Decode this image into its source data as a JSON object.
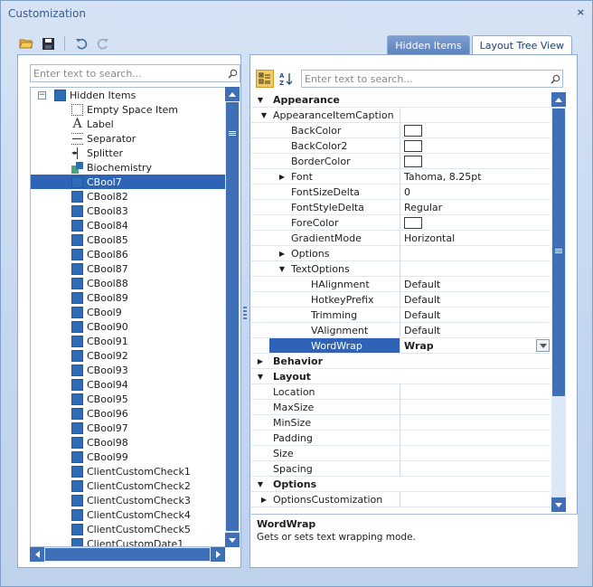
{
  "window": {
    "title": "Customization",
    "close_glyph": "×"
  },
  "toolbar": {
    "icons": [
      "open-folder-icon",
      "save-icon",
      "undo-icon",
      "redo-icon"
    ]
  },
  "tabs": [
    {
      "label": "Hidden Items",
      "active": false
    },
    {
      "label": "Layout Tree View",
      "active": true
    }
  ],
  "left": {
    "search_placeholder": "Enter text to search...",
    "tree": [
      {
        "label": "Hidden Items",
        "icon": "box",
        "level": 0,
        "expander": "minus"
      },
      {
        "label": "Empty Space Item",
        "icon": "empty",
        "level": 1
      },
      {
        "label": "Label",
        "icon": "label",
        "level": 1
      },
      {
        "label": "Separator",
        "icon": "separator",
        "level": 1
      },
      {
        "label": "Splitter",
        "icon": "splitter",
        "level": 1
      },
      {
        "label": "Biochemistry",
        "icon": "group",
        "level": 1
      },
      {
        "label": "CBool7",
        "icon": "box",
        "level": 1,
        "selected": true
      },
      {
        "label": "CBool82",
        "icon": "box",
        "level": 1
      },
      {
        "label": "CBool83",
        "icon": "box",
        "level": 1
      },
      {
        "label": "CBool84",
        "icon": "box",
        "level": 1
      },
      {
        "label": "CBool85",
        "icon": "box",
        "level": 1
      },
      {
        "label": "CBool86",
        "icon": "box",
        "level": 1
      },
      {
        "label": "CBool87",
        "icon": "box",
        "level": 1
      },
      {
        "label": "CBool88",
        "icon": "box",
        "level": 1
      },
      {
        "label": "CBool89",
        "icon": "box",
        "level": 1
      },
      {
        "label": "CBool9",
        "icon": "box",
        "level": 1
      },
      {
        "label": "CBool90",
        "icon": "box",
        "level": 1
      },
      {
        "label": "CBool91",
        "icon": "box",
        "level": 1
      },
      {
        "label": "CBool92",
        "icon": "box",
        "level": 1
      },
      {
        "label": "CBool93",
        "icon": "box",
        "level": 1
      },
      {
        "label": "CBool94",
        "icon": "box",
        "level": 1
      },
      {
        "label": "CBool95",
        "icon": "box",
        "level": 1
      },
      {
        "label": "CBool96",
        "icon": "box",
        "level": 1
      },
      {
        "label": "CBool97",
        "icon": "box",
        "level": 1
      },
      {
        "label": "CBool98",
        "icon": "box",
        "level": 1
      },
      {
        "label": "CBool99",
        "icon": "box",
        "level": 1
      },
      {
        "label": "ClientCustomCheck1",
        "icon": "box",
        "level": 1
      },
      {
        "label": "ClientCustomCheck2",
        "icon": "box",
        "level": 1
      },
      {
        "label": "ClientCustomCheck3",
        "icon": "box",
        "level": 1
      },
      {
        "label": "ClientCustomCheck4",
        "icon": "box",
        "level": 1
      },
      {
        "label": "ClientCustomCheck5",
        "icon": "box",
        "level": 1
      },
      {
        "label": "ClientCustomDate1",
        "icon": "box",
        "level": 1
      }
    ]
  },
  "right": {
    "search_placeholder": "Enter text to search...",
    "header_icons": [
      "categorized-icon",
      "alphabetical-sort-icon"
    ],
    "rows": [
      {
        "type": "cat",
        "name": "Appearance",
        "exp": "down"
      },
      {
        "name": "AppearanceItemCaption",
        "level": 0,
        "exp": "down",
        "val": ""
      },
      {
        "name": "BackColor",
        "level": 1,
        "val": "",
        "color": true
      },
      {
        "name": "BackColor2",
        "level": 1,
        "val": "",
        "color": true
      },
      {
        "name": "BorderColor",
        "level": 1,
        "val": "",
        "color": true
      },
      {
        "name": "Font",
        "level": 1,
        "exp": "right",
        "val": "Tahoma, 8.25pt"
      },
      {
        "name": "FontSizeDelta",
        "level": 1,
        "val": "0"
      },
      {
        "name": "FontStyleDelta",
        "level": 1,
        "val": "Regular"
      },
      {
        "name": "ForeColor",
        "level": 1,
        "val": "",
        "color": true
      },
      {
        "name": "GradientMode",
        "level": 1,
        "val": "Horizontal"
      },
      {
        "name": "Options",
        "level": 1,
        "exp": "right",
        "val": ""
      },
      {
        "name": "TextOptions",
        "level": 1,
        "exp": "down",
        "val": ""
      },
      {
        "name": "HAlignment",
        "level": 2,
        "val": "Default"
      },
      {
        "name": "HotkeyPrefix",
        "level": 2,
        "val": "Default"
      },
      {
        "name": "Trimming",
        "level": 2,
        "val": "Default"
      },
      {
        "name": "VAlignment",
        "level": 2,
        "val": "Default"
      },
      {
        "name": "WordWrap",
        "level": 2,
        "val": "Wrap",
        "selected": true,
        "combo": true
      },
      {
        "type": "cat",
        "name": "Behavior",
        "exp": "right"
      },
      {
        "type": "cat",
        "name": "Layout",
        "exp": "down"
      },
      {
        "name": "Location",
        "level": 0,
        "val": ""
      },
      {
        "name": "MaxSize",
        "level": 0,
        "val": ""
      },
      {
        "name": "MinSize",
        "level": 0,
        "val": ""
      },
      {
        "name": "Padding",
        "level": 0,
        "val": ""
      },
      {
        "name": "Size",
        "level": 0,
        "val": ""
      },
      {
        "name": "Spacing",
        "level": 0,
        "val": ""
      },
      {
        "type": "cat",
        "name": "Options",
        "exp": "down"
      },
      {
        "name": "OptionsCustomization",
        "level": 0,
        "exp": "right",
        "val": ""
      }
    ],
    "description": {
      "title": "WordWrap",
      "text": "Gets or sets text wrapping mode."
    }
  },
  "colors": {
    "accent": "#2e63b8",
    "scrollbar": "#3f6fb7",
    "tab_active_bg": "#ffffff",
    "tab_inactive_bg": "#5c82bd"
  }
}
